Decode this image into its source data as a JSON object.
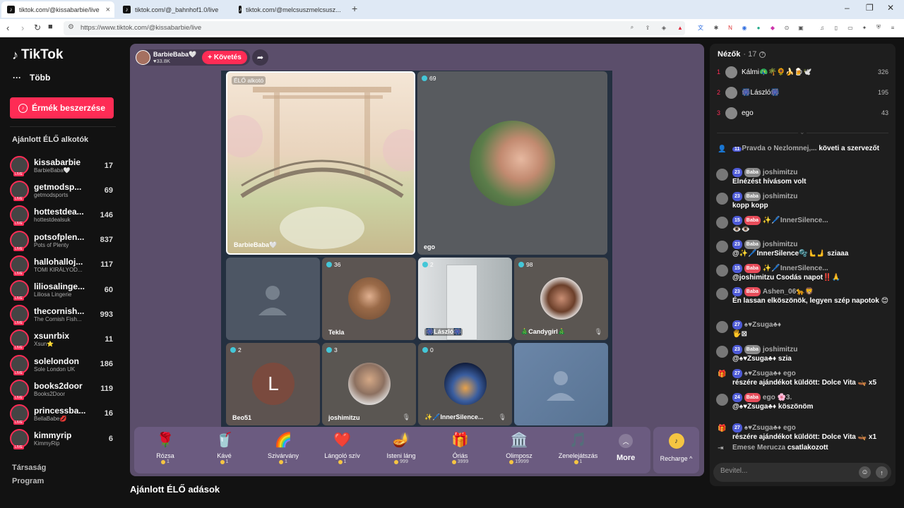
{
  "browser": {
    "tabs": [
      {
        "label": "tiktok.com/@kissabarbie/live",
        "active": true
      },
      {
        "label": "tiktok.com/@_bahnhof1.0/live",
        "active": false
      },
      {
        "label": "tiktok.com/@melcsuszmelcsusz...",
        "active": false
      }
    ],
    "url": "https://www.tiktok.com/@kissabarbie/live"
  },
  "sidebar": {
    "logo": "TikTok",
    "more": "Több",
    "coin_button": "Érmék beszerzése",
    "section_title": "Ajánlott ÉLŐ alkotók",
    "channels": [
      {
        "name": "kissabarbie",
        "sub": "BarbieBaba🤍",
        "count": "17"
      },
      {
        "name": "getmodsp...",
        "sub": "getmodsports",
        "count": "69"
      },
      {
        "name": "hottestdea...",
        "sub": "hottestdealsuk",
        "count": "146"
      },
      {
        "name": "potsofplen...",
        "sub": "Pots of Plenty",
        "count": "837"
      },
      {
        "name": "hallohalloj...",
        "sub": "TOMI KIRÁLYOD...",
        "count": "117"
      },
      {
        "name": "liliosalinge...",
        "sub": "Liliosa Lingerie",
        "count": "60"
      },
      {
        "name": "thecornish...",
        "sub": "The Cornish Fish...",
        "count": "993"
      },
      {
        "name": "xsunrbix",
        "sub": "Xsun⭐",
        "count": "11"
      },
      {
        "name": "solelondon",
        "sub": "Sole London UK",
        "count": "186"
      },
      {
        "name": "books2door",
        "sub": "Books2Door",
        "count": "119"
      },
      {
        "name": "princessba...",
        "sub": "BellaBabe💋",
        "count": "16"
      },
      {
        "name": "kimmyrip",
        "sub": "KimmyRip",
        "count": "6"
      }
    ],
    "footer": [
      "Társaság",
      "Program"
    ]
  },
  "host": {
    "name": "BarbieBaba🤍",
    "likes": "♥33.8K",
    "follow": "+ Követés"
  },
  "cells": [
    {
      "badge": "ÉLŐ alkotó",
      "name": "BarbieBaba🤍"
    },
    {
      "badge": "69",
      "name": "ego"
    },
    {
      "badge": "",
      "name": ""
    },
    {
      "badge": "36",
      "name": "Tekla"
    },
    {
      "badge": "2",
      "name": "🎆László🎆"
    },
    {
      "badge": "98",
      "name": "🎄Candygirl🎄"
    },
    {
      "badge": "2",
      "name": "Beo51",
      "initial": "L"
    },
    {
      "badge": "3",
      "name": "joshimitzu"
    },
    {
      "badge": "0",
      "name": "✨🖊️InnerSilence..."
    },
    {
      "badge": "",
      "name": ""
    }
  ],
  "gifts": [
    {
      "icon": "🌹",
      "name": "Rózsa",
      "price": "1"
    },
    {
      "icon": "🥤",
      "name": "Kávé",
      "price": "1"
    },
    {
      "icon": "🌈",
      "name": "Szivárvány",
      "price": "1"
    },
    {
      "icon": "❤️",
      "name": "Lángoló szív",
      "price": "1"
    },
    {
      "icon": "🪔",
      "name": "Isteni láng",
      "price": "999"
    },
    {
      "icon": "🎁",
      "name": "Óriás",
      "price": "3999"
    },
    {
      "icon": "🏛️",
      "name": "Olimposz",
      "price": "19999"
    },
    {
      "icon": "🎵",
      "name": "Zenelejátszás",
      "price": "1"
    }
  ],
  "more_label": "More",
  "recharge_label": "Recharge ^",
  "recommended": "Ajánlott ÉLŐ adások",
  "viewers": {
    "title": "Nézők",
    "count": "· 17",
    "list": [
      {
        "rank": "1",
        "name": "Kálmi🦚🌴🌻🍌🍺🕊️",
        "score": "326"
      },
      {
        "rank": "2",
        "name": "🎆László🎆",
        "score": "195"
      },
      {
        "rank": "3",
        "name": "ego",
        "score": "43"
      }
    ]
  },
  "chat": [
    {
      "type": "sys",
      "level": "11",
      "user": "Pravda o Nezlomnej,...",
      "text": "követi a szervezőt"
    },
    {
      "level": "23",
      "fan": "Baba",
      "user": "joshimitzu",
      "text": "Elnézést hívásom volt"
    },
    {
      "level": "23",
      "fan": "Baba",
      "user": "joshimitzu",
      "text": "kopp kopp"
    },
    {
      "level": "15",
      "fan": "Baba",
      "red": true,
      "user": "✨🖊️InnerSilence...",
      "text": "👁️👁️"
    },
    {
      "level": "23",
      "fan": "Baba",
      "user": "joshimitzu",
      "text": "@✨🖊️InnerSilence🫧🫷🫸 sziaaa"
    },
    {
      "level": "15",
      "fan": "Baba",
      "red": true,
      "user": "✨🖊️InnerSilence...",
      "text": "@joshimitzu Csodás napot‼️🙏"
    },
    {
      "level": "23",
      "fan": "Baba",
      "red": true,
      "user": "Ashen_06🐆🦁",
      "text": "Én lassan elköszönök, legyen szép napotok 😊"
    },
    {
      "level": "27",
      "fan": "",
      "user": "♠♥Zsuga♣♦",
      "text": "🖐️⊠"
    },
    {
      "level": "23",
      "fan": "Baba",
      "user": "joshimitzu",
      "text": "@♠♥Zsuga♣♦ szia"
    },
    {
      "type": "gift",
      "level": "27",
      "user": "♠♥Zsuga♣♦ ego",
      "text": "részére ajándékot küldött: Dolce Vita 🛶 x5"
    },
    {
      "level": "24",
      "fan": "Baba",
      "red": true,
      "user": "ego 🌸3.",
      "text": "@♠♥Zsuga♣♦ köszönöm"
    },
    {
      "type": "gift",
      "level": "27",
      "user": "♠♥Zsuga♣♦ ego",
      "text": "részére ajándékot küldött: Dolce Vita 🛶 x1"
    },
    {
      "type": "join",
      "user": "Emese Merucza",
      "text": "csatlakozott"
    }
  ],
  "input_placeholder": "Bevitel...",
  "colors": {
    "accent": "#fe2c55",
    "stage": "#5b4e6b",
    "panel": "#1e1e1e"
  }
}
